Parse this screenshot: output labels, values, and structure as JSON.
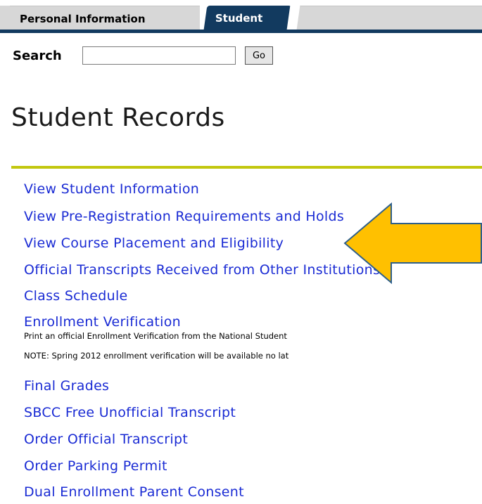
{
  "tabs": {
    "personal_label": "Personal Information",
    "student_label": "Student"
  },
  "search": {
    "label": "Search",
    "value": "",
    "placeholder": "",
    "go_label": "Go"
  },
  "page_title": "Student Records",
  "menu": {
    "items": [
      {
        "label": "View Student Information"
      },
      {
        "label": "View Pre-Registration Requirements and Holds"
      },
      {
        "label": "View Course Placement and Eligibility"
      },
      {
        "label": "Official Transcripts Received from Other Institutions"
      },
      {
        "label": "Class Schedule"
      },
      {
        "label": "Enrollment Verification"
      },
      {
        "label": "Final Grades"
      },
      {
        "label": "SBCC Free Unofficial Transcript"
      },
      {
        "label": "Order Official Transcript"
      },
      {
        "label": "Order Parking Permit"
      },
      {
        "label": "Dual Enrollment Parent Consent"
      }
    ],
    "enrollment_desc": "Print an official Enrollment Verification from the National Student",
    "enrollment_note": "NOTE: Spring 2012 enrollment verification will be available no lat"
  },
  "colors": {
    "tab_active": "#123a5f",
    "tab_inactive": "#d7d7d7",
    "link": "#1a2bd4",
    "rule": "#c2c70f",
    "arrow_fill": "#ffc000",
    "arrow_stroke": "#2e5f8a"
  },
  "icons": {
    "arrow": "left-arrow-icon"
  }
}
